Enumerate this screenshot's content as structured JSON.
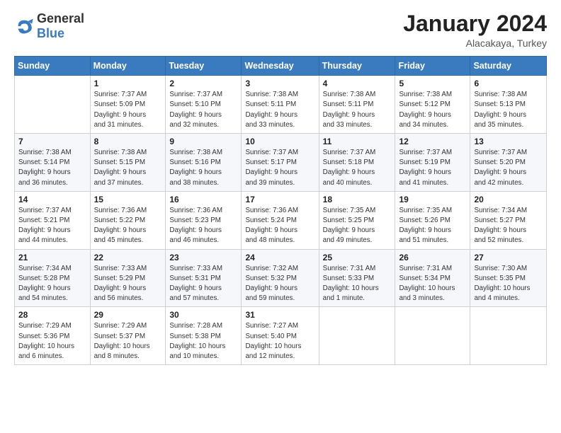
{
  "logo": {
    "text_general": "General",
    "text_blue": "Blue"
  },
  "header": {
    "month_year": "January 2024",
    "location": "Alacakaya, Turkey"
  },
  "weekdays": [
    "Sunday",
    "Monday",
    "Tuesday",
    "Wednesday",
    "Thursday",
    "Friday",
    "Saturday"
  ],
  "weeks": [
    [
      {
        "day": "",
        "info": ""
      },
      {
        "day": "1",
        "info": "Sunrise: 7:37 AM\nSunset: 5:09 PM\nDaylight: 9 hours\nand 31 minutes."
      },
      {
        "day": "2",
        "info": "Sunrise: 7:37 AM\nSunset: 5:10 PM\nDaylight: 9 hours\nand 32 minutes."
      },
      {
        "day": "3",
        "info": "Sunrise: 7:38 AM\nSunset: 5:11 PM\nDaylight: 9 hours\nand 33 minutes."
      },
      {
        "day": "4",
        "info": "Sunrise: 7:38 AM\nSunset: 5:11 PM\nDaylight: 9 hours\nand 33 minutes."
      },
      {
        "day": "5",
        "info": "Sunrise: 7:38 AM\nSunset: 5:12 PM\nDaylight: 9 hours\nand 34 minutes."
      },
      {
        "day": "6",
        "info": "Sunrise: 7:38 AM\nSunset: 5:13 PM\nDaylight: 9 hours\nand 35 minutes."
      }
    ],
    [
      {
        "day": "7",
        "info": "Sunrise: 7:38 AM\nSunset: 5:14 PM\nDaylight: 9 hours\nand 36 minutes."
      },
      {
        "day": "8",
        "info": "Sunrise: 7:38 AM\nSunset: 5:15 PM\nDaylight: 9 hours\nand 37 minutes."
      },
      {
        "day": "9",
        "info": "Sunrise: 7:38 AM\nSunset: 5:16 PM\nDaylight: 9 hours\nand 38 minutes."
      },
      {
        "day": "10",
        "info": "Sunrise: 7:37 AM\nSunset: 5:17 PM\nDaylight: 9 hours\nand 39 minutes."
      },
      {
        "day": "11",
        "info": "Sunrise: 7:37 AM\nSunset: 5:18 PM\nDaylight: 9 hours\nand 40 minutes."
      },
      {
        "day": "12",
        "info": "Sunrise: 7:37 AM\nSunset: 5:19 PM\nDaylight: 9 hours\nand 41 minutes."
      },
      {
        "day": "13",
        "info": "Sunrise: 7:37 AM\nSunset: 5:20 PM\nDaylight: 9 hours\nand 42 minutes."
      }
    ],
    [
      {
        "day": "14",
        "info": "Sunrise: 7:37 AM\nSunset: 5:21 PM\nDaylight: 9 hours\nand 44 minutes."
      },
      {
        "day": "15",
        "info": "Sunrise: 7:36 AM\nSunset: 5:22 PM\nDaylight: 9 hours\nand 45 minutes."
      },
      {
        "day": "16",
        "info": "Sunrise: 7:36 AM\nSunset: 5:23 PM\nDaylight: 9 hours\nand 46 minutes."
      },
      {
        "day": "17",
        "info": "Sunrise: 7:36 AM\nSunset: 5:24 PM\nDaylight: 9 hours\nand 48 minutes."
      },
      {
        "day": "18",
        "info": "Sunrise: 7:35 AM\nSunset: 5:25 PM\nDaylight: 9 hours\nand 49 minutes."
      },
      {
        "day": "19",
        "info": "Sunrise: 7:35 AM\nSunset: 5:26 PM\nDaylight: 9 hours\nand 51 minutes."
      },
      {
        "day": "20",
        "info": "Sunrise: 7:34 AM\nSunset: 5:27 PM\nDaylight: 9 hours\nand 52 minutes."
      }
    ],
    [
      {
        "day": "21",
        "info": "Sunrise: 7:34 AM\nSunset: 5:28 PM\nDaylight: 9 hours\nand 54 minutes."
      },
      {
        "day": "22",
        "info": "Sunrise: 7:33 AM\nSunset: 5:29 PM\nDaylight: 9 hours\nand 56 minutes."
      },
      {
        "day": "23",
        "info": "Sunrise: 7:33 AM\nSunset: 5:31 PM\nDaylight: 9 hours\nand 57 minutes."
      },
      {
        "day": "24",
        "info": "Sunrise: 7:32 AM\nSunset: 5:32 PM\nDaylight: 9 hours\nand 59 minutes."
      },
      {
        "day": "25",
        "info": "Sunrise: 7:31 AM\nSunset: 5:33 PM\nDaylight: 10 hours\nand 1 minute."
      },
      {
        "day": "26",
        "info": "Sunrise: 7:31 AM\nSunset: 5:34 PM\nDaylight: 10 hours\nand 3 minutes."
      },
      {
        "day": "27",
        "info": "Sunrise: 7:30 AM\nSunset: 5:35 PM\nDaylight: 10 hours\nand 4 minutes."
      }
    ],
    [
      {
        "day": "28",
        "info": "Sunrise: 7:29 AM\nSunset: 5:36 PM\nDaylight: 10 hours\nand 6 minutes."
      },
      {
        "day": "29",
        "info": "Sunrise: 7:29 AM\nSunset: 5:37 PM\nDaylight: 10 hours\nand 8 minutes."
      },
      {
        "day": "30",
        "info": "Sunrise: 7:28 AM\nSunset: 5:38 PM\nDaylight: 10 hours\nand 10 minutes."
      },
      {
        "day": "31",
        "info": "Sunrise: 7:27 AM\nSunset: 5:40 PM\nDaylight: 10 hours\nand 12 minutes."
      },
      {
        "day": "",
        "info": ""
      },
      {
        "day": "",
        "info": ""
      },
      {
        "day": "",
        "info": ""
      }
    ]
  ]
}
